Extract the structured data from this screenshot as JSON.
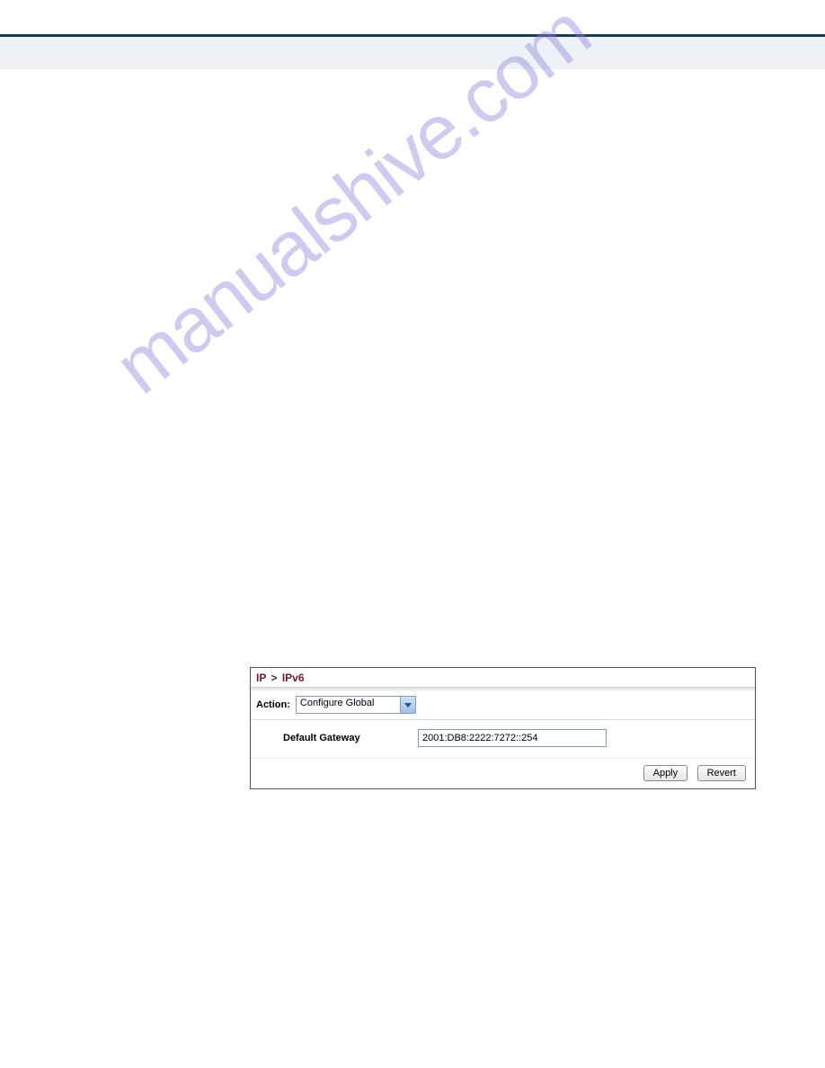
{
  "watermark": "manualshive.com",
  "panel": {
    "breadcrumb1": "IP",
    "breadcrumb2": "IPv6",
    "action_label": "Action:",
    "action_value": "Configure Global",
    "gateway_label": "Default Gateway",
    "gateway_value": "2001:DB8:2222:7272::254",
    "apply": "Apply",
    "revert": "Revert"
  }
}
